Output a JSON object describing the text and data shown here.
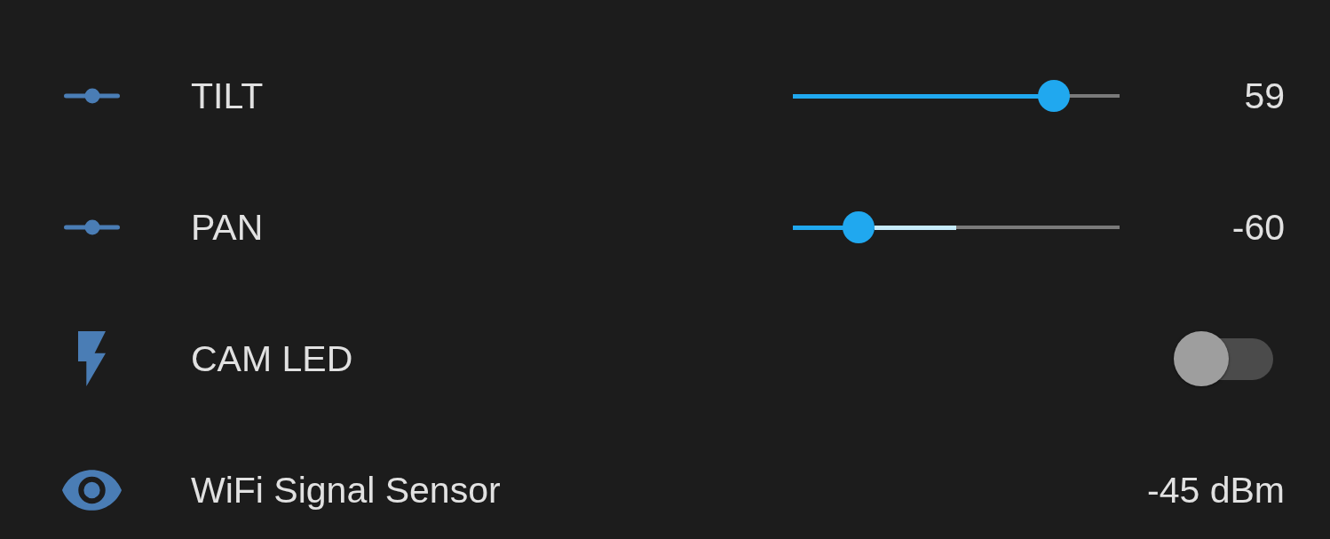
{
  "entities": [
    {
      "kind": "slider",
      "name": "TILT",
      "level": 0.8,
      "value": "59"
    },
    {
      "kind": "slider",
      "name": "PAN",
      "level": 0.2,
      "centered": true,
      "value": "-60"
    },
    {
      "kind": "toggle",
      "name": "CAM LED",
      "on": false
    },
    {
      "kind": "sensor",
      "name": "WiFi Signal Sensor",
      "value": "-45 dBm"
    }
  ]
}
